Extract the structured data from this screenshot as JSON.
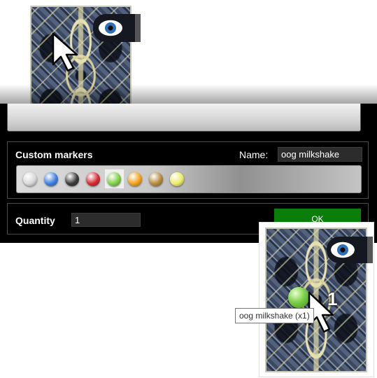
{
  "markers_section": {
    "title": "Custom markers",
    "name_label": "Name:",
    "name_value": "oog milkshake",
    "selected_index": 4,
    "markers": [
      {
        "name": "white-marker",
        "color": "#d8d8d8"
      },
      {
        "name": "blue-marker",
        "color": "#3f7fe0"
      },
      {
        "name": "black-marker",
        "color": "#3a3a3a"
      },
      {
        "name": "red-marker",
        "color": "#d42a32"
      },
      {
        "name": "green-marker",
        "color": "#7fd04a"
      },
      {
        "name": "orange-marker",
        "color": "#f2a21a"
      },
      {
        "name": "brown-marker",
        "color": "#b48d3c"
      },
      {
        "name": "yellow-marker",
        "color": "#ecec6a"
      }
    ]
  },
  "quantity_section": {
    "label": "Quantity",
    "value": "1"
  },
  "ok_button": {
    "label": "OK",
    "color": "#0b7d0b"
  },
  "placed_card": {
    "marker_count": "1",
    "tooltip": "oog milkshake (x1)"
  }
}
